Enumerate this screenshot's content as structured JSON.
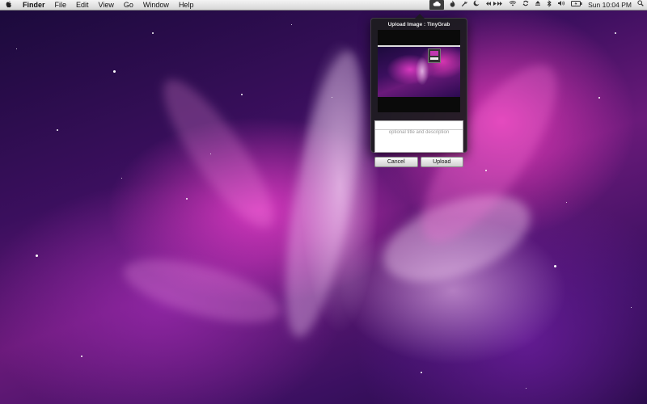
{
  "menubar": {
    "apple_icon": "apple-logo-icon",
    "items": [
      {
        "label": "Finder"
      },
      {
        "label": "File"
      },
      {
        "label": "Edit"
      },
      {
        "label": "View"
      },
      {
        "label": "Go"
      },
      {
        "label": "Window"
      },
      {
        "label": "Help"
      }
    ],
    "status_icons": [
      "tinygrab-cloud-icon",
      "flame-icon",
      "wrench-icon",
      "moon-icon",
      "media-controls-icon",
      "wifi-icon",
      "sync-icon",
      "eject-icon",
      "bluetooth-icon",
      "volume-icon",
      "battery-icon"
    ],
    "clock": "Sun 10:04 PM",
    "search_icon": "spotlight-search-icon"
  },
  "popup": {
    "title": "Upload Image : TinyGrab",
    "description_placeholder": "optional title and description",
    "cancel_label": "Cancel",
    "upload_label": "Upload"
  },
  "colors": {
    "popup_bg": "#1c1c1e",
    "wallpaper_accent": "#e03cc8"
  }
}
